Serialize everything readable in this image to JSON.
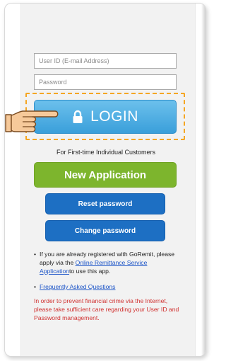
{
  "form": {
    "user_id_placeholder": "User ID (E-mail Address)",
    "password_placeholder": "Password"
  },
  "login": {
    "label": "LOGIN",
    "icon": "lock-icon",
    "pointer_icon": "pointing-hand-icon",
    "highlight_color": "#f5a623"
  },
  "first_time": {
    "caption": "For First-time Individual Customers",
    "new_application_label": "New Application",
    "new_application_color": "#7db52d"
  },
  "account": {
    "reset_password_label": "Reset password",
    "change_password_label": "Change password",
    "button_color": "#1d6fc3"
  },
  "notes": {
    "bullet": "•",
    "registered_text_1": "If you are already registered with GoRemit, please apply via the ",
    "registered_link": "Online Remittance Service Application",
    "registered_text_2": "to use this app.",
    "faq_link": "Frequently Asked Questions",
    "warning": "In order to prevent financial crime via the Internet, please take sufficient care regarding your User ID and Password management.",
    "warning_color": "#d0302f",
    "link_color": "#1e56c8"
  }
}
